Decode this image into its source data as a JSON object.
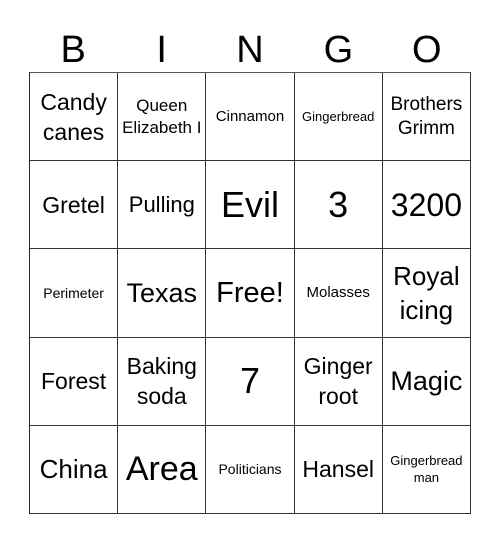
{
  "header": {
    "letters": [
      "B",
      "I",
      "N",
      "G",
      "O"
    ]
  },
  "board": {
    "rows": [
      [
        "Candy canes",
        "Queen Elizabeth I",
        "Cinnamon",
        "Gingerbread",
        "Brothers Grimm"
      ],
      [
        "Gretel",
        "Pulling",
        "Evil",
        "3",
        "3200"
      ],
      [
        "Perimeter",
        "Texas",
        "Free!",
        "Molasses",
        "Royal icing"
      ],
      [
        "Forest",
        "Baking soda",
        "7",
        "Ginger root",
        "Magic"
      ],
      [
        "China",
        "Area",
        "Politicians",
        "Hansel",
        "Gingerbread man"
      ]
    ]
  }
}
